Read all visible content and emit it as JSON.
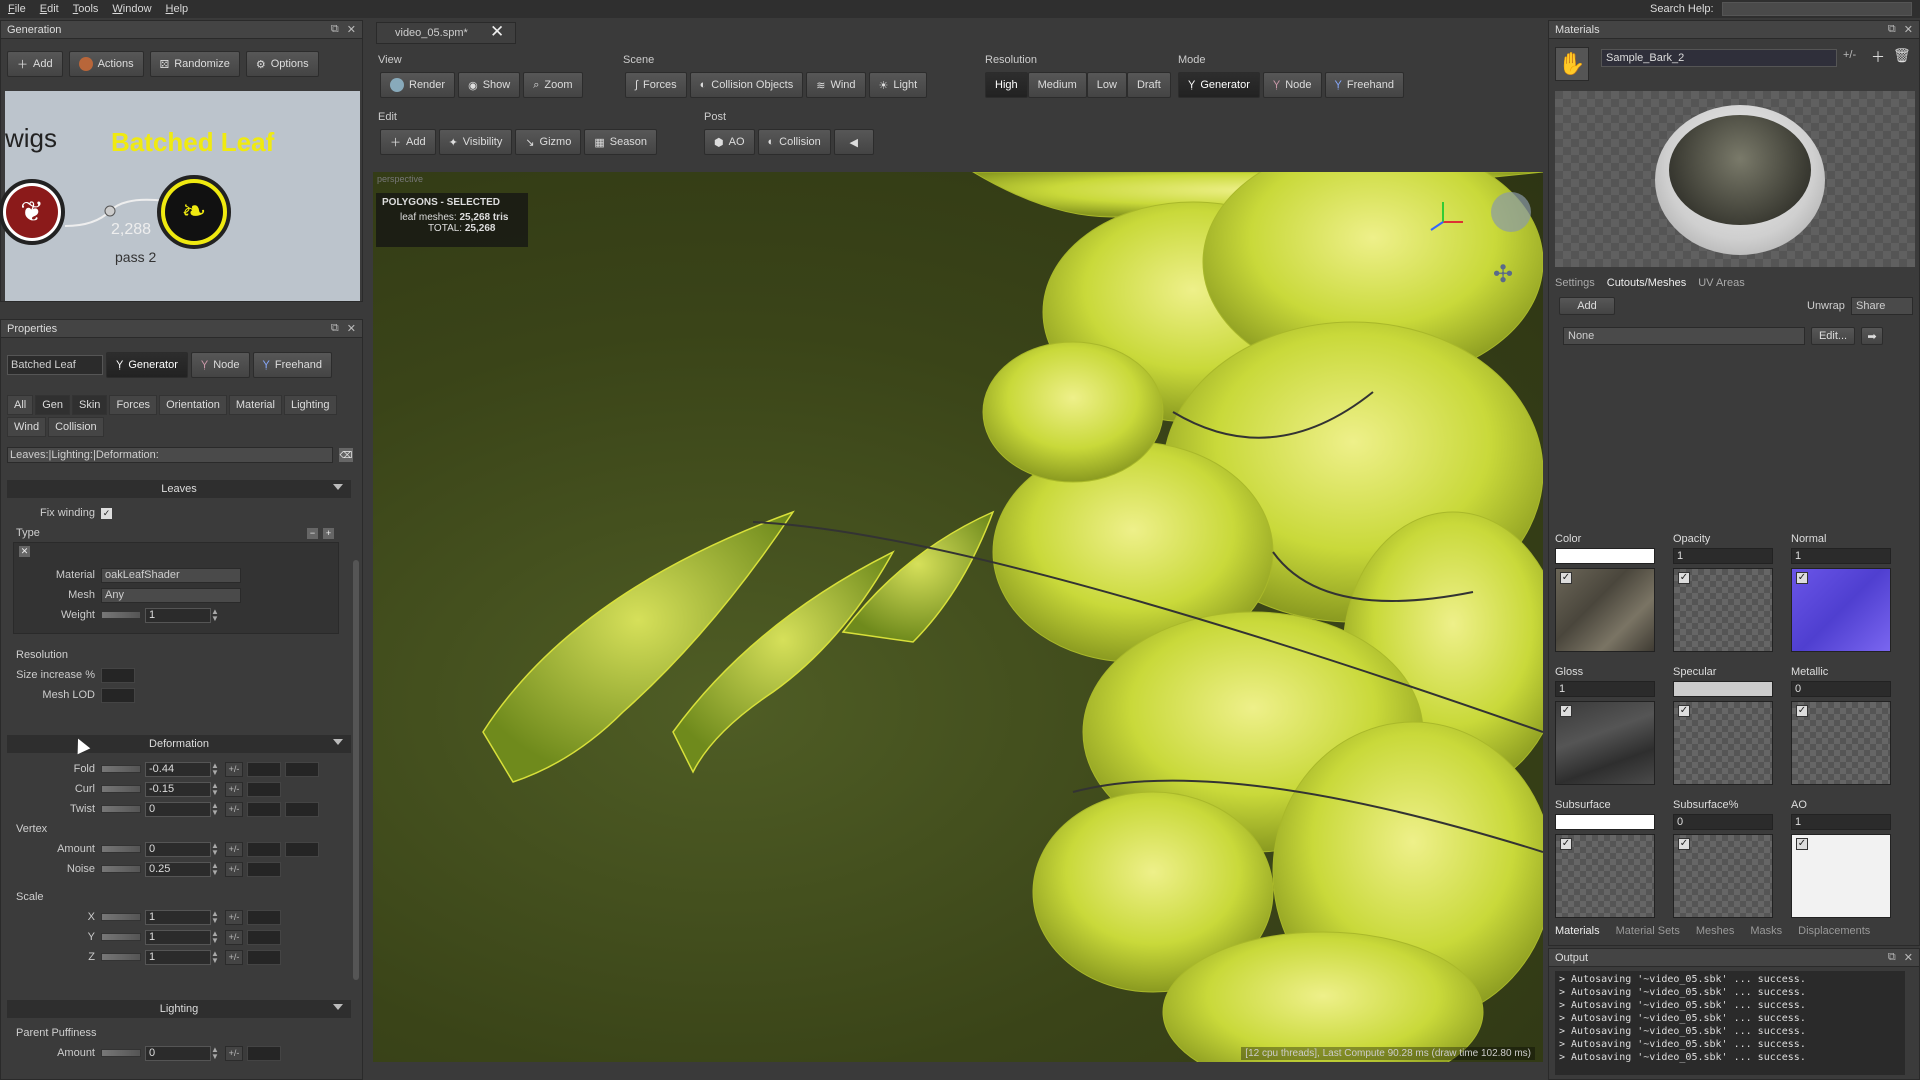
{
  "menu": [
    "File",
    "Edit",
    "Tools",
    "Window",
    "Help"
  ],
  "search_label": "Search Help:",
  "generation": {
    "title": "Generation",
    "buttons": [
      "Add",
      "Actions",
      "Randomize",
      "Options"
    ],
    "graph": {
      "left_label": "wigs",
      "node_title": "Batched Leaf",
      "count": "2,288",
      "pass": "pass 2"
    }
  },
  "properties": {
    "title": "Properties",
    "name": "Batched Leaf",
    "mode_buttons": [
      "Generator",
      "Node",
      "Freehand"
    ],
    "tabs": [
      "All",
      "Gen",
      "Skin",
      "Forces",
      "Orientation",
      "Material",
      "Lighting",
      "Wind",
      "Collision"
    ],
    "filter": "Leaves:|Lighting:|Deformation:",
    "leaves_section": "Leaves",
    "fix_winding": "Fix winding",
    "type_label": "Type",
    "material_label": "Material",
    "material_value": "oakLeafShader",
    "mesh_label": "Mesh",
    "mesh_value": "Any",
    "weight_label": "Weight",
    "weight_value": "1",
    "resolution_label": "Resolution",
    "size_increase": "Size increase %",
    "mesh_lod": "Mesh LOD",
    "deformation_section": "Deformation",
    "fold": {
      "label": "Fold",
      "value": "-0.44"
    },
    "curl": {
      "label": "Curl",
      "value": "-0.15"
    },
    "twist": {
      "label": "Twist",
      "value": "0"
    },
    "vertex_label": "Vertex",
    "amount": {
      "label": "Amount",
      "value": "0"
    },
    "noise": {
      "label": "Noise",
      "value": "0.25"
    },
    "scale_label": "Scale",
    "sx": {
      "label": "X",
      "value": "1"
    },
    "sy": {
      "label": "Y",
      "value": "1"
    },
    "sz": {
      "label": "Z",
      "value": "1"
    },
    "lighting_section": "Lighting",
    "parent_puffiness": "Parent Puffiness",
    "pp_amount": {
      "label": "Amount",
      "value": "0"
    },
    "pm": "+/-"
  },
  "document_tab": "video_05.spm*",
  "toolbar": {
    "view": {
      "label": "View",
      "buttons": [
        "Render",
        "Show",
        "Zoom"
      ]
    },
    "scene": {
      "label": "Scene",
      "buttons": [
        "Forces",
        "Collision Objects",
        "Wind",
        "Light"
      ]
    },
    "resolution": {
      "label": "Resolution",
      "buttons": [
        "High",
        "Medium",
        "Low",
        "Draft"
      ]
    },
    "mode": {
      "label": "Mode",
      "buttons": [
        "Generator",
        "Node",
        "Freehand"
      ]
    },
    "edit": {
      "label": "Edit",
      "buttons": [
        "Add",
        "Visibility",
        "Gizmo",
        "Season"
      ]
    },
    "post": {
      "label": "Post",
      "buttons": [
        "AO",
        "Collision"
      ]
    }
  },
  "viewport": {
    "perspective": "perspective",
    "info_title": "POLYGONS - SELECTED",
    "leaf_meshes_label": "leaf meshes:",
    "leaf_meshes_value": "25,268 tris",
    "total_label": "TOTAL:",
    "total_value": "25,268",
    "status": "[12 cpu threads], Last Compute 90.28 ms (draw time 102.80 ms)"
  },
  "materials": {
    "title": "Materials",
    "selected": "Sample_Bark_2",
    "tabs": [
      "Settings",
      "Cutouts/Meshes",
      "UV Areas"
    ],
    "add": "Add",
    "unwrap": "Unwrap",
    "share": "Share",
    "none": "None",
    "edit": "Edit...",
    "slots": [
      {
        "name": "Color",
        "value": "",
        "swatch": "#ffffff",
        "tex": "bark"
      },
      {
        "name": "Opacity",
        "value": "1",
        "swatch": "",
        "tex": "checker"
      },
      {
        "name": "Normal",
        "value": "1",
        "swatch": "",
        "tex": "normal"
      },
      {
        "name": "Gloss",
        "value": "1",
        "swatch": "",
        "tex": "dark"
      },
      {
        "name": "Specular",
        "value": "",
        "swatch": "#cccccc",
        "tex": "checker"
      },
      {
        "name": "Metallic",
        "value": "0",
        "swatch": "",
        "tex": "checker"
      },
      {
        "name": "Subsurface",
        "value": "",
        "swatch": "#ffffff",
        "tex": "checker"
      },
      {
        "name": "Subsurface%",
        "value": "0",
        "swatch": "",
        "tex": "checker"
      },
      {
        "name": "AO",
        "value": "1",
        "swatch": "",
        "tex": "white"
      }
    ],
    "bottom_tabs": [
      "Materials",
      "Material Sets",
      "Meshes",
      "Masks",
      "Displacements"
    ]
  },
  "output": {
    "title": "Output",
    "lines": [
      "> Autosaving '~video_05.sbk' ... success.",
      "> Autosaving '~video_05.sbk' ... success.",
      "> Autosaving '~video_05.sbk' ... success.",
      "> Autosaving '~video_05.sbk' ... success.",
      "> Autosaving '~video_05.sbk' ... success.",
      "> Autosaving '~video_05.sbk' ... success.",
      "> Autosaving '~video_05.sbk' ... success."
    ]
  },
  "colors": {
    "leaf": "#c9d93a",
    "accent": "#f0ea10"
  }
}
